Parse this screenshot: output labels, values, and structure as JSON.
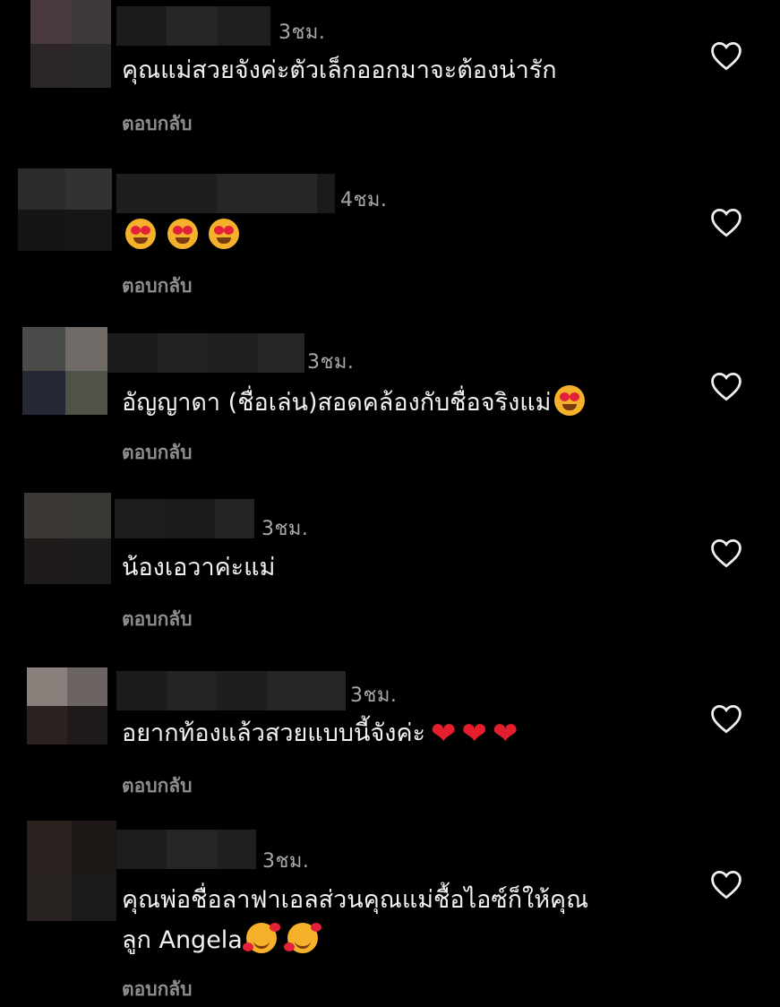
{
  "reply_label": "ตอบกลับ",
  "comments": [
    {
      "time": "3ชม.",
      "text": "คุณแม่สวยจังค่ะตัวเล็กออกมาจะต้องน่ารัก",
      "avatar_colors": [
        "#4a3a40",
        "#3e3a3b",
        "#2c2629",
        "#2a2829"
      ]
    },
    {
      "time": "4ชม.",
      "text": "",
      "emoji": [
        "heart-eyes",
        "heart-eyes",
        "heart-eyes"
      ],
      "avatar_colors": [
        "#2b2b2b",
        "#333132",
        "#151515",
        "#161616"
      ]
    },
    {
      "time": "3ชม.",
      "text": "อัญญาดา (ชื่อเล่น)สอดคล้องกับชื่อจริงแม่",
      "emoji": [
        "heart-eyes"
      ],
      "avatar_colors": [
        "#4a4a48",
        "#6f6a66",
        "#232834",
        "#4f5246"
      ]
    },
    {
      "time": "3ชม.",
      "text": "น้องเอวาค่ะแม่",
      "avatar_colors": [
        "#3e3834",
        "#3a3835",
        "#1e1a19",
        "#1b1b1b"
      ]
    },
    {
      "time": "3ชม.",
      "text": "อยากท้องแล้วสวยแบบนี้จังค่ะ",
      "emoji": [
        "red-heart",
        "red-heart",
        "red-heart"
      ],
      "avatar_colors": [
        "#8a807b",
        "#6b6462",
        "#2c2222",
        "#1f1a1a"
      ]
    },
    {
      "time": "3ชม.",
      "text": "คุณพ่อชื่อลาฟาเอลส่วนคุณแม่ชื้อไอซ์ก็ให้คุณ",
      "text2": "ลูก Angela",
      "emoji": [
        "smiling-hearts",
        "smiling-hearts"
      ],
      "avatar_colors": [
        "#2a211e",
        "#1d1716",
        "#27221f",
        "#1c1919"
      ]
    }
  ],
  "colors": {
    "background": "#000000",
    "text": "#f2f2f2",
    "muted": "#8e8e8e",
    "time": "#a8a8a8"
  }
}
